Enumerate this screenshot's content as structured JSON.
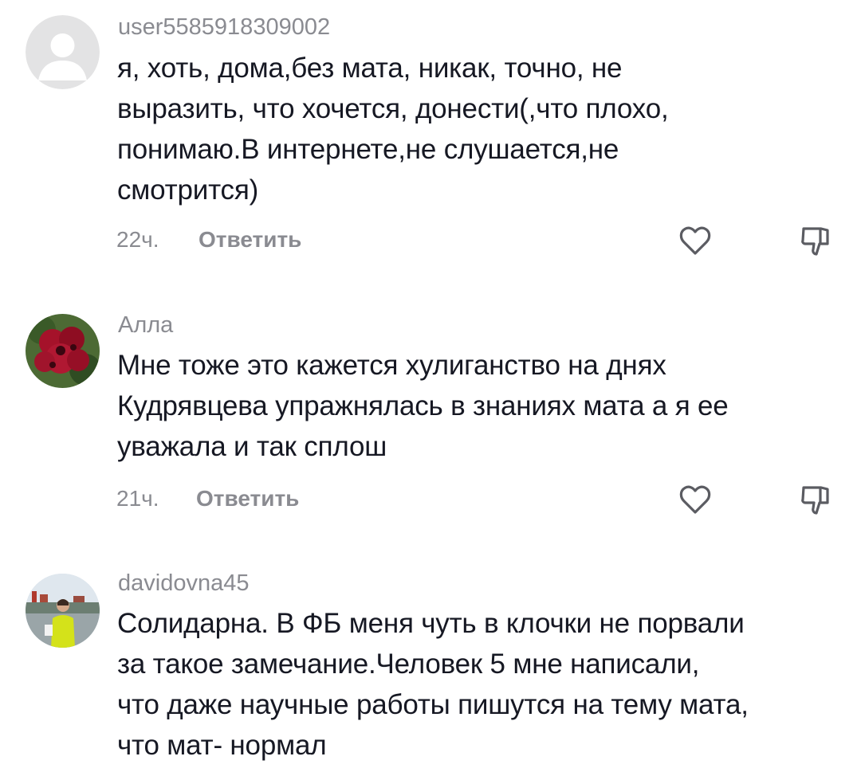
{
  "comments": [
    {
      "username": "user5585918309002",
      "lines": [
        "я, хоть, дома,без мата, никак, точно, не",
        "выразить, что хочется, донести(,что плохо,",
        "понимаю.В интернете,не слушается,не",
        "смотрится)"
      ],
      "time": "22ч.",
      "reply_label": "Ответить",
      "avatar": "default-avatar-icon"
    },
    {
      "username": "Алла",
      "lines": [
        "Мне тоже это кажется хулиганство на днях",
        "Кудрявцева упражнялась в знаниях мата а я ее",
        "уважала и так сплош"
      ],
      "time": "21ч.",
      "reply_label": "Ответить",
      "avatar": "flower-photo"
    },
    {
      "username": "davidovna45",
      "lines": [
        "Солидарна. В ФБ меня чуть в клочки не порвали",
        "за такое замечание.Человек 5 мне написали,",
        "что даже научные работы пишутся на тему мата,",
        "что мат- нормал"
      ],
      "avatar": "person-photo"
    }
  ],
  "icons": {
    "like": "heart-outline-icon",
    "dislike": "thumbs-down-outline-icon"
  },
  "colors": {
    "text": "#161823",
    "secondary": "#8a8b91",
    "background": "#ffffff"
  }
}
